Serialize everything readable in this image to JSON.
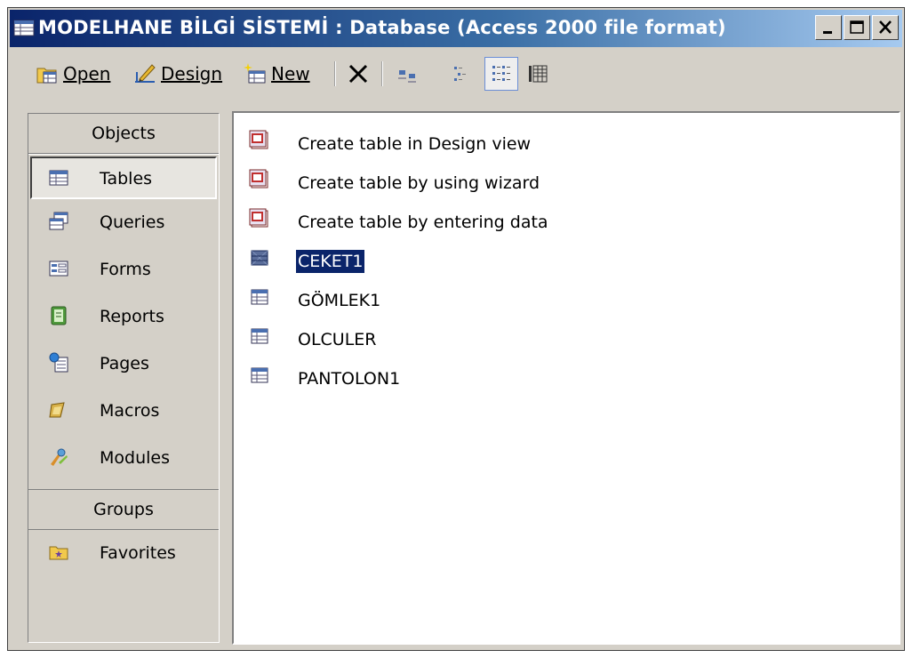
{
  "window": {
    "title": "MODELHANE BİLGİ SİSTEMİ : Database (Access 2000 file format)",
    "controls": [
      "minimize",
      "maximize",
      "close"
    ]
  },
  "toolbar": {
    "open_label": "Open",
    "design_label": "Design",
    "new_label": "New"
  },
  "sidebar": {
    "objects_header": "Objects",
    "items": [
      {
        "label": "Tables",
        "icon": "table-icon",
        "selected": true
      },
      {
        "label": "Queries",
        "icon": "query-icon"
      },
      {
        "label": "Forms",
        "icon": "form-icon"
      },
      {
        "label": "Reports",
        "icon": "report-icon"
      },
      {
        "label": "Pages",
        "icon": "page-icon"
      },
      {
        "label": "Macros",
        "icon": "macro-icon"
      },
      {
        "label": "Modules",
        "icon": "module-icon"
      }
    ],
    "groups_header": "Groups",
    "groups": [
      {
        "label": "Favorites",
        "icon": "favorites-folder-icon"
      }
    ]
  },
  "list": {
    "items": [
      {
        "label": "Create table in Design view",
        "icon": "shortcut-icon"
      },
      {
        "label": "Create table by using wizard",
        "icon": "shortcut-icon"
      },
      {
        "label": "Create table by entering data",
        "icon": "shortcut-icon"
      },
      {
        "label": "CEKET1",
        "icon": "table-icon",
        "selected": true
      },
      {
        "label": "GÖMLEK1",
        "icon": "table-icon"
      },
      {
        "label": "OLCULER",
        "icon": "table-icon"
      },
      {
        "label": "PANTOLON1",
        "icon": "table-icon"
      }
    ]
  },
  "colors": {
    "titlebar_start": "#0a246a",
    "titlebar_end": "#a6caf0",
    "selection": "#0a246a",
    "chrome": "#d4d0c8"
  }
}
